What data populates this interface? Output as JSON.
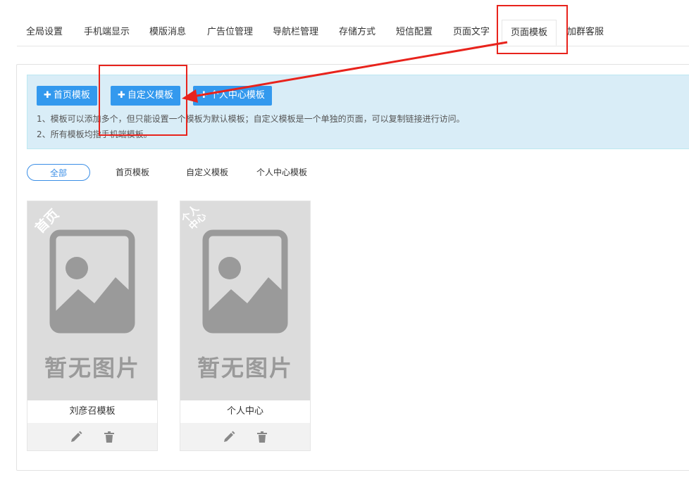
{
  "tabs": [
    {
      "label": "全局设置"
    },
    {
      "label": "手机端显示"
    },
    {
      "label": "模版消息"
    },
    {
      "label": "广告位管理"
    },
    {
      "label": "导航栏管理"
    },
    {
      "label": "存储方式"
    },
    {
      "label": "短信配置"
    },
    {
      "label": "页面文字"
    },
    {
      "label": "页面模板"
    },
    {
      "label": "加群客服"
    }
  ],
  "active_tab": "页面模板",
  "buttons": {
    "home_template": "首页模板",
    "custom_template": "自定义模板",
    "personal_template": "个人中心模板"
  },
  "tips": {
    "line1": "1、模板可以添加多个，但只能设置一个模板为默认模板；自定义模板是一个单独的页面，可以复制链接进行访问。",
    "line2": "2、所有模板均指手机端模板。"
  },
  "filters": [
    {
      "label": "全部"
    },
    {
      "label": "首页模板"
    },
    {
      "label": "自定义模板"
    },
    {
      "label": "个人中心模板"
    }
  ],
  "cards": [
    {
      "name": "刘彦召模板",
      "ribbon": "首页",
      "ribbon_color": "#e60012",
      "placeholder": "暂无图片"
    },
    {
      "name": "个人中心",
      "ribbon": "个人\n中心",
      "ribbon_line1": "个人",
      "ribbon_line2": "中心",
      "ribbon_color": "#f0a848",
      "placeholder": "暂无图片"
    }
  ],
  "colors": {
    "primary": "#3399ee",
    "tip_bg": "#d9edf7",
    "annotation": "#e8231c"
  }
}
